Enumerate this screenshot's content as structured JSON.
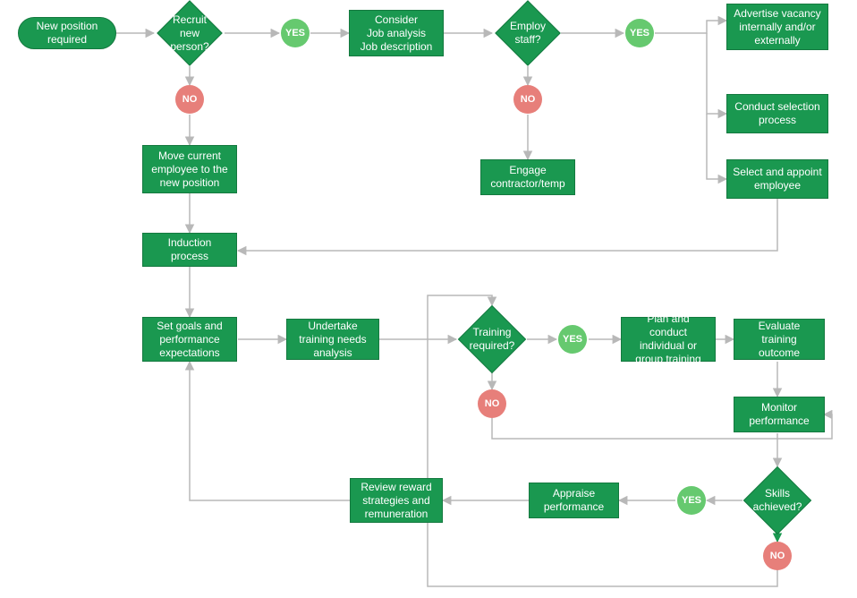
{
  "nodes": {
    "start": "New position required",
    "recruit": "Recruit new person?",
    "consider": "Consider\nJob analysis\nJob description",
    "employ": "Employ staff?",
    "advertise": "Advertise vacancy internally and/or externally",
    "selection": "Conduct selection process",
    "appoint": "Select and appoint employee",
    "move": "Move current employee to the new position",
    "engage": "Engage contractor/temp",
    "induction": "Induction process",
    "goals": "Set goals and performance expectations",
    "undertake": "Undertake training needs analysis",
    "training": "Training required?",
    "plan": "Plan and conduct individual or group training",
    "evaluate": "Evaluate training outcome",
    "monitor": "Monitor performance",
    "skills": "Skills achieved?",
    "appraise": "Appraise performance",
    "review": "Review reward strategies and remuneration"
  },
  "labels": {
    "yes": "YES",
    "no": "NO"
  },
  "colors": {
    "process": "#1a9850",
    "yes": "#66c96f",
    "no": "#e77f7a",
    "arrow": "#b8b8b8",
    "arrow_green": "#1a9850"
  }
}
